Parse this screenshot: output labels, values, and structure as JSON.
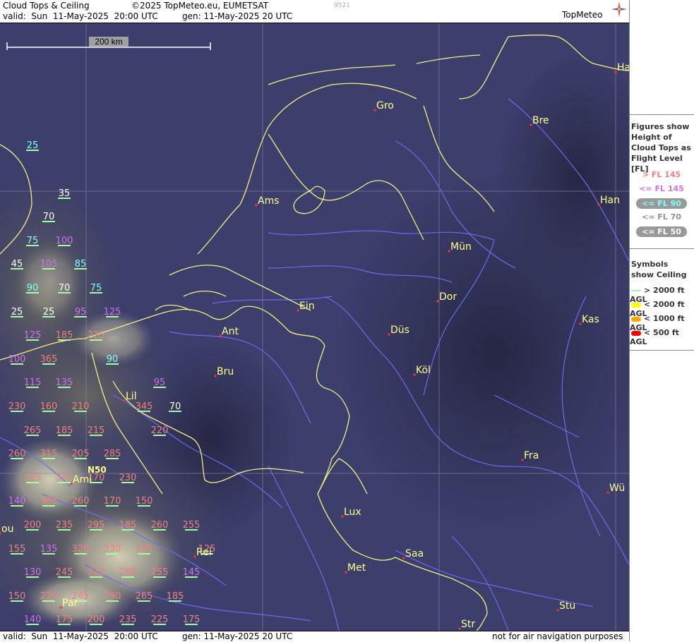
{
  "header": {
    "title": "Cloud Tops & Ceiling",
    "copyright": "©2025 TopMeteo.eu, EUMETSAT",
    "small_code": "9521",
    "valid": "valid:  Sun  11-May-2025  20:00 UTC",
    "gen": "gen: 11-May-2025 20 UTC",
    "logo": "TopMeteo"
  },
  "footer": {
    "valid": "valid:  Sun  11-May-2025  20:00 UTC",
    "gen": "gen: 11-May-2025 20 UTC",
    "disclaimer": "not for air navigation purposes"
  },
  "map": {
    "scale_label": "200 km",
    "lat_label": "N50",
    "cities": [
      {
        "name": "Ha"
      },
      {
        "name": "Gro"
      },
      {
        "name": "Bre"
      },
      {
        "name": "Han"
      },
      {
        "name": "Ams"
      },
      {
        "name": "Mün"
      },
      {
        "name": "Dor"
      },
      {
        "name": "Ein"
      },
      {
        "name": "Kas"
      },
      {
        "name": "Ant"
      },
      {
        "name": "Düs"
      },
      {
        "name": "Bru"
      },
      {
        "name": "Köl"
      },
      {
        "name": "Lil"
      },
      {
        "name": "Fra"
      },
      {
        "name": "Ami"
      },
      {
        "name": "Wü"
      },
      {
        "name": "Lux"
      },
      {
        "name": "Rei"
      },
      {
        "name": "Saa"
      },
      {
        "name": "Met"
      },
      {
        "name": "Par"
      },
      {
        "name": "Stu"
      },
      {
        "name": "Str"
      },
      {
        "name": "ou"
      }
    ],
    "flight_levels": [
      {
        "v": "25",
        "c": "cyan"
      },
      {
        "v": "35",
        "c": "white"
      },
      {
        "v": "70",
        "c": "white"
      },
      {
        "v": "75",
        "c": "cyan"
      },
      {
        "v": "100",
        "c": "violet"
      },
      {
        "v": "45",
        "c": "white"
      },
      {
        "v": "105",
        "c": "violet"
      },
      {
        "v": "85",
        "c": "cyan"
      },
      {
        "v": "90",
        "c": "cyan"
      },
      {
        "v": "70",
        "c": "white"
      },
      {
        "v": "75",
        "c": "cyan"
      },
      {
        "v": "25",
        "c": "white"
      },
      {
        "v": "25",
        "c": "white"
      },
      {
        "v": "95",
        "c": "violet"
      },
      {
        "v": "125",
        "c": "violet"
      },
      {
        "v": "125",
        "c": "violet"
      },
      {
        "v": "185",
        "c": "pink"
      },
      {
        "v": "225",
        "c": "pink"
      },
      {
        "v": "100",
        "c": "violet"
      },
      {
        "v": "365",
        "c": "pink"
      },
      {
        "v": "90",
        "c": "cyan"
      },
      {
        "v": "115",
        "c": "violet"
      },
      {
        "v": "135",
        "c": "violet"
      },
      {
        "v": "95",
        "c": "violet"
      },
      {
        "v": "230",
        "c": "pink"
      },
      {
        "v": "160",
        "c": "pink"
      },
      {
        "v": "210",
        "c": "pink"
      },
      {
        "v": "345",
        "c": "pink"
      },
      {
        "v": "70",
        "c": "white"
      },
      {
        "v": "265",
        "c": "pink"
      },
      {
        "v": "185",
        "c": "pink"
      },
      {
        "v": "215",
        "c": "pink"
      },
      {
        "v": "220",
        "c": "pink"
      },
      {
        "v": "260",
        "c": "pink"
      },
      {
        "v": "315",
        "c": "pink"
      },
      {
        "v": "205",
        "c": "pink"
      },
      {
        "v": "285",
        "c": "pink"
      },
      {
        "v": "325",
        "c": "pink"
      },
      {
        "v": "315",
        "c": "pink"
      },
      {
        "v": "170",
        "c": "pink"
      },
      {
        "v": "230",
        "c": "pink"
      },
      {
        "v": "140",
        "c": "violet"
      },
      {
        "v": "305",
        "c": "pink"
      },
      {
        "v": "260",
        "c": "pink"
      },
      {
        "v": "170",
        "c": "pink"
      },
      {
        "v": "150",
        "c": "pink"
      },
      {
        "v": "200",
        "c": "pink"
      },
      {
        "v": "235",
        "c": "pink"
      },
      {
        "v": "295",
        "c": "pink"
      },
      {
        "v": "185",
        "c": "pink"
      },
      {
        "v": "260",
        "c": "pink"
      },
      {
        "v": "255",
        "c": "pink"
      },
      {
        "v": "155",
        "c": "pink"
      },
      {
        "v": "135",
        "c": "violet"
      },
      {
        "v": "320",
        "c": "pink"
      },
      {
        "v": "330",
        "c": "pink"
      },
      {
        "v": "165",
        "c": "pink"
      },
      {
        "v": "125",
        "c": "pink"
      },
      {
        "v": "130",
        "c": "violet"
      },
      {
        "v": "245",
        "c": "pink"
      },
      {
        "v": "320",
        "c": "pink"
      },
      {
        "v": "280",
        "c": "pink"
      },
      {
        "v": "255",
        "c": "pink"
      },
      {
        "v": "145",
        "c": "violet"
      },
      {
        "v": "150",
        "c": "pink"
      },
      {
        "v": "220",
        "c": "pink"
      },
      {
        "v": "245",
        "c": "pink"
      },
      {
        "v": "290",
        "c": "pink"
      },
      {
        "v": "265",
        "c": "pink"
      },
      {
        "v": "185",
        "c": "pink"
      },
      {
        "v": "140",
        "c": "violet"
      },
      {
        "v": "175",
        "c": "pink"
      },
      {
        "v": "200",
        "c": "pink"
      },
      {
        "v": "235",
        "c": "pink"
      },
      {
        "v": "225",
        "c": "pink"
      },
      {
        "v": "175",
        "c": "pink"
      }
    ]
  },
  "legend": {
    "figures_title": "Figures show Height of Cloud Tops as Flight Level  [FL]",
    "fl_rows": [
      {
        "label": "> FL 145",
        "color": "#f08080"
      },
      {
        "label": "<= FL 145",
        "color": "#d070f0"
      },
      {
        "label": "<= FL 90",
        "color": "#80ffff"
      },
      {
        "label": "<= FL 70",
        "color": "#909090"
      },
      {
        "label": "<= FL 50",
        "color": "#ffffff"
      }
    ],
    "symbols_title": "Symbols show Ceiling",
    "symbol_rows": [
      {
        "label": "> 2000 ft AGL",
        "color": "#a0ffa0"
      },
      {
        "label": "< 2000 ft AGL",
        "color": "#ffff00"
      },
      {
        "label": "< 1000 ft AGL",
        "color": "#ffa500"
      },
      {
        "label": "< 500 ft AGL",
        "color": "#ff0000"
      }
    ],
    "colors": {
      "cyan": "#80ffff",
      "white": "#ffffff",
      "violet": "#d070f0",
      "pink": "#f08080",
      "city": "#ffff90",
      "coast": "#ffff80",
      "river": "#6a6af0"
    }
  }
}
